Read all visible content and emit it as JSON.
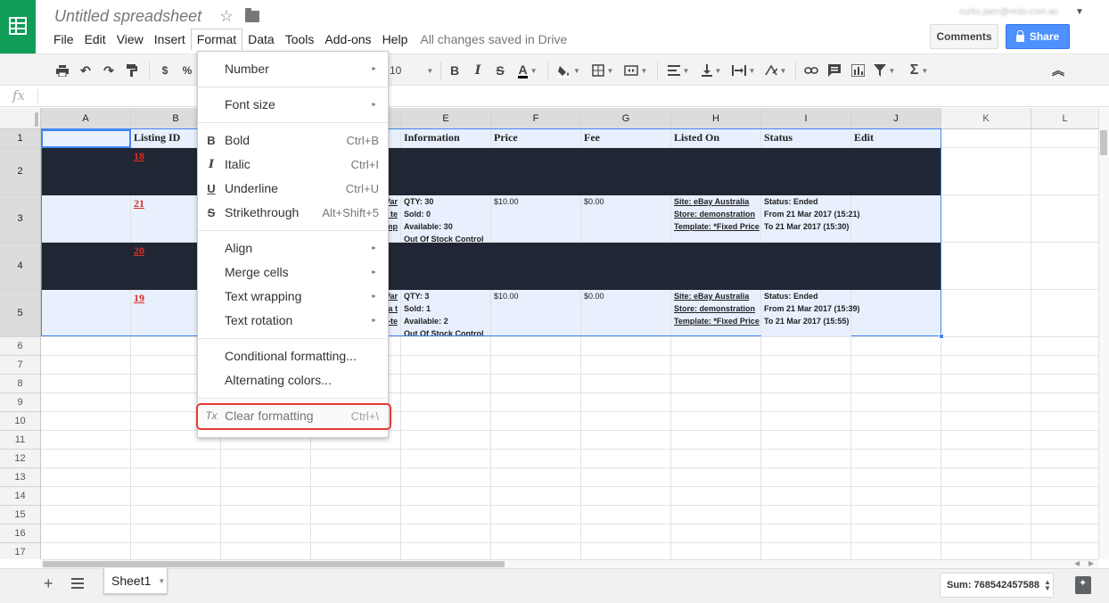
{
  "app": {
    "title": "Untitled spreadsheet",
    "saved_status": "All changes saved in Drive",
    "account": "curtis.jaen@redo.com.au",
    "comments_label": "Comments",
    "share_label": "Share"
  },
  "menubar": [
    "File",
    "Edit",
    "View",
    "Insert",
    "Format",
    "Data",
    "Tools",
    "Add-ons",
    "Help"
  ],
  "toolbar": {
    "currency": "$",
    "percent": "%",
    "font_size": "10"
  },
  "formula_bar": {
    "fx_label": "fx",
    "value": ""
  },
  "columns": [
    "A",
    "B",
    "C",
    "D",
    "E",
    "F",
    "G",
    "H",
    "I",
    "J",
    "K",
    "L"
  ],
  "rows": [
    "1",
    "2",
    "3",
    "4",
    "5",
    "6",
    "7",
    "8",
    "9",
    "10",
    "11",
    "12",
    "13",
    "14",
    "15",
    "16",
    "17"
  ],
  "sheet": {
    "headers": {
      "B": "Listing ID",
      "E": "Information",
      "F": "Price",
      "G": "Fee",
      "H": "Listed On",
      "I": "Status",
      "J": "Edit"
    },
    "listing_ids": [
      "18",
      "21",
      "20",
      "19"
    ],
    "row3": {
      "d_lines": [
        "Var",
        "e: te",
        "mp"
      ],
      "info": [
        "QTY: 30",
        "Sold: 0",
        "Available: 30",
        "Out Of Stock Control"
      ],
      "price": "$10.00",
      "fee": "$0.00",
      "listed": [
        "Site: eBay Australia",
        "Store: demonstration",
        "Template: *Fixed Price"
      ],
      "status": [
        "Status: Ended",
        "From 21 Mar 2017 (15:21)",
        "To 21 Mar 2017 (15:30)"
      ]
    },
    "row5": {
      "d_lines": [
        "Var",
        "a t",
        "t-te"
      ],
      "info": [
        "QTY: 3",
        "Sold: 1",
        "Available: 2",
        "Out Of Stock Control"
      ],
      "price": "$10.00",
      "fee": "$0.00",
      "listed": [
        "Site: eBay Australia",
        "Store: demonstration",
        "Template: *Fixed Price"
      ],
      "status": [
        "Status: Ended",
        "From 21 Mar 2017 (15:39)",
        "To 21 Mar 2017 (15:55)"
      ]
    }
  },
  "format_menu": {
    "items": [
      {
        "label": "Number",
        "submenu": true
      },
      {
        "label": "Font size",
        "submenu": true
      },
      {
        "label": "Bold",
        "shortcut": "Ctrl+B",
        "icon": "bold-icon",
        "glyph": "B"
      },
      {
        "label": "Italic",
        "shortcut": "Ctrl+I",
        "icon": "italic-icon",
        "glyph": "I"
      },
      {
        "label": "Underline",
        "shortcut": "Ctrl+U",
        "icon": "underline-icon",
        "glyph": "U"
      },
      {
        "label": "Strikethrough",
        "shortcut": "Alt+Shift+5",
        "icon": "strikethrough-icon",
        "glyph": "S"
      },
      {
        "label": "Align",
        "submenu": true
      },
      {
        "label": "Merge cells",
        "submenu": true
      },
      {
        "label": "Text wrapping",
        "submenu": true
      },
      {
        "label": "Text rotation",
        "submenu": true
      },
      {
        "label": "Conditional formatting..."
      },
      {
        "label": "Alternating colors..."
      },
      {
        "label": "Clear formatting",
        "shortcut": "Ctrl+\\",
        "icon": "clear-formatting-icon",
        "glyph": "Tx"
      }
    ]
  },
  "bottom": {
    "sheet_tab": "Sheet1",
    "sum": "Sum: 768542457588"
  },
  "colors": {
    "brand_green": "#0f9d58",
    "share_blue": "#4d90fe",
    "dark_row": "#212635",
    "selection": "#4285f4",
    "highlight_red": "#e53935",
    "listing_id_red": "#d93025"
  }
}
